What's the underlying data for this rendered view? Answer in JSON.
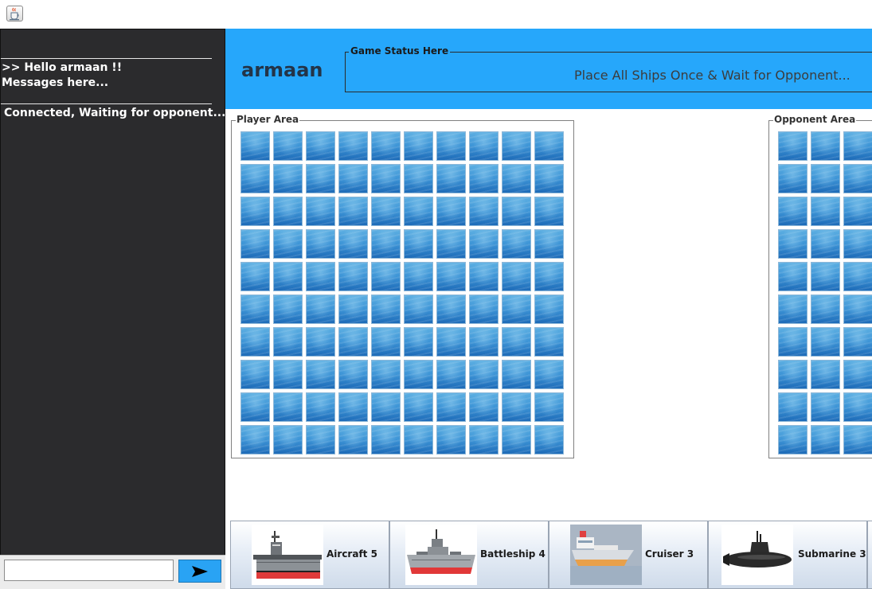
{
  "window": {
    "icon": "java-cup-icon"
  },
  "sidebar": {
    "greeting": ">> Hello armaan !!",
    "messages_hint": "Messages here...",
    "connection_status": "Connected, Waiting for opponent...",
    "chat_input_value": "",
    "send_icon": "send-arrow-icon"
  },
  "header": {
    "player_name": "armaan",
    "status_legend": "Game Status Here",
    "status_text": "Place All Ships Once & Wait for Opponent..."
  },
  "player_area": {
    "legend": "Player Area",
    "rows": 10,
    "cols": 10,
    "cell_icon": "water-tile"
  },
  "opponent_area": {
    "legend": "Opponent Area",
    "rows": 10,
    "cols": 3,
    "cell_icon": "water-tile"
  },
  "ships": [
    {
      "label": "Aircraft 5",
      "icon": "aircraft-carrier-icon"
    },
    {
      "label": "Battleship 4",
      "icon": "battleship-icon"
    },
    {
      "label": "Cruiser 3",
      "icon": "cruiser-icon"
    },
    {
      "label": "Submarine 3",
      "icon": "submarine-icon"
    }
  ],
  "colors": {
    "header_bg": "#26a7fb",
    "sidebar_bg": "#2b2b2d",
    "send_button": "#29a3f4",
    "player_name": "#233448"
  }
}
